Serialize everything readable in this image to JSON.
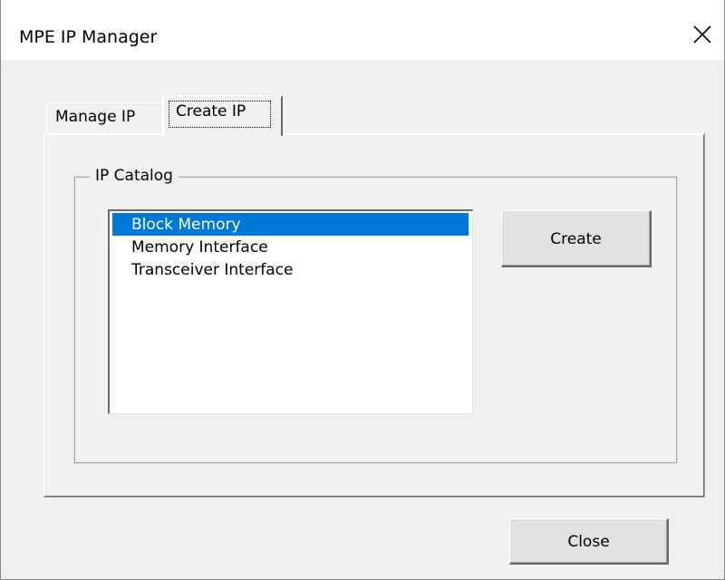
{
  "window": {
    "title": "MPE IP Manager"
  },
  "tabs": [
    {
      "label": "Manage IP",
      "selected": false
    },
    {
      "label": "Create IP",
      "selected": true
    }
  ],
  "ip_catalog": {
    "group_label": "IP Catalog",
    "items": [
      {
        "label": "Block Memory",
        "selected": true
      },
      {
        "label": "Memory Interface",
        "selected": false
      },
      {
        "label": "Transceiver Interface",
        "selected": false
      }
    ]
  },
  "buttons": {
    "create_label": "Create",
    "close_label": "Close"
  },
  "colors": {
    "selection": "#0078d7",
    "background": "#f0f0f0"
  },
  "icons": {
    "close": "close-icon"
  }
}
